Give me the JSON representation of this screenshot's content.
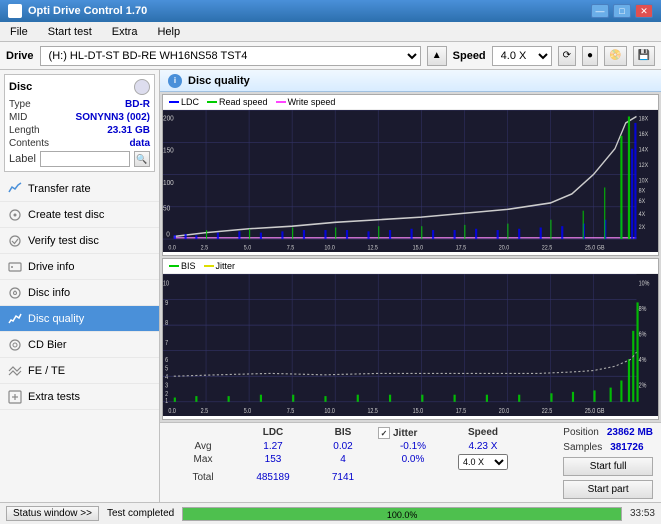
{
  "app": {
    "title": "Opti Drive Control 1.70",
    "icon": "disc-icon"
  },
  "title_bar": {
    "buttons": {
      "minimize": "—",
      "maximize": "□",
      "close": "✕"
    }
  },
  "menu": {
    "items": [
      "File",
      "Start test",
      "Extra",
      "Help"
    ]
  },
  "drive_bar": {
    "drive_label": "Drive",
    "drive_value": "(H:)  HL-DT-ST BD-RE  WH16NS58 TST4",
    "speed_label": "Speed",
    "speed_value": "4.0 X",
    "eject_label": "▲"
  },
  "disc": {
    "title": "Disc",
    "type_label": "Type",
    "type_value": "BD-R",
    "mid_label": "MID",
    "mid_value": "SONYNN3 (002)",
    "length_label": "Length",
    "length_value": "23.31 GB",
    "contents_label": "Contents",
    "contents_value": "data",
    "label_label": "Label",
    "label_placeholder": ""
  },
  "nav": {
    "items": [
      {
        "id": "transfer-rate",
        "label": "Transfer rate",
        "icon": "chart-icon"
      },
      {
        "id": "create-test-disc",
        "label": "Create test disc",
        "icon": "disc-create-icon"
      },
      {
        "id": "verify-test-disc",
        "label": "Verify test disc",
        "icon": "disc-verify-icon"
      },
      {
        "id": "drive-info",
        "label": "Drive info",
        "icon": "info-icon"
      },
      {
        "id": "disc-info",
        "label": "Disc info",
        "icon": "disc-info-icon"
      },
      {
        "id": "disc-quality",
        "label": "Disc quality",
        "icon": "quality-icon",
        "active": true
      },
      {
        "id": "cd-bier",
        "label": "CD Bier",
        "icon": "cd-icon"
      },
      {
        "id": "fe-te",
        "label": "FE / TE",
        "icon": "fete-icon"
      },
      {
        "id": "extra-tests",
        "label": "Extra tests",
        "icon": "extra-icon"
      }
    ]
  },
  "panel": {
    "title": "Disc quality"
  },
  "chart_top": {
    "legend": {
      "ldc": "LDC",
      "read_speed": "Read speed",
      "write_speed": "Write speed"
    },
    "y_axis": {
      "left_max": "200",
      "left_mid": "150",
      "left_100": "100",
      "left_50": "50",
      "left_0": "0",
      "right_labels": [
        "18X",
        "16X",
        "14X",
        "12X",
        "10X",
        "8X",
        "6X",
        "4X",
        "2X"
      ]
    },
    "x_axis": [
      "0.0",
      "2.5",
      "5.0",
      "7.5",
      "10.0",
      "12.5",
      "15.0",
      "17.5",
      "20.0",
      "22.5",
      "25.0 GB"
    ]
  },
  "chart_bottom": {
    "legend": {
      "bis": "BIS",
      "jitter": "Jitter"
    },
    "y_axis": {
      "left_labels": [
        "10",
        "9",
        "8",
        "7",
        "6",
        "5",
        "4",
        "3",
        "2",
        "1"
      ],
      "right_labels": [
        "10%",
        "8%",
        "6%",
        "4%",
        "2%"
      ]
    },
    "x_axis": [
      "0.0",
      "2.5",
      "5.0",
      "7.5",
      "10.0",
      "12.5",
      "15.0",
      "17.5",
      "20.0",
      "22.5",
      "25.0 GB"
    ]
  },
  "stats": {
    "headers": [
      "",
      "LDC",
      "BIS",
      "",
      "Jitter",
      "Speed",
      ""
    ],
    "avg_label": "Avg",
    "avg_ldc": "1.27",
    "avg_bis": "0.02",
    "avg_jitter": "-0.1%",
    "max_label": "Max",
    "max_ldc": "153",
    "max_bis": "4",
    "max_jitter": "0.0%",
    "total_label": "Total",
    "total_ldc": "485189",
    "total_bis": "7141",
    "jitter_checked": true,
    "jitter_label": "Jitter",
    "speed_label": "Speed",
    "speed_value": "4.23 X",
    "speed_select": "4.0 X",
    "position_label": "Position",
    "position_value": "23862 MB",
    "samples_label": "Samples",
    "samples_value": "381726",
    "btn_start_full": "Start full",
    "btn_start_part": "Start part"
  },
  "status_bar": {
    "window_btn": "Status window >>",
    "progress_value": 100,
    "progress_text": "100.0%",
    "status_text": "Test completed",
    "time": "33:53"
  }
}
